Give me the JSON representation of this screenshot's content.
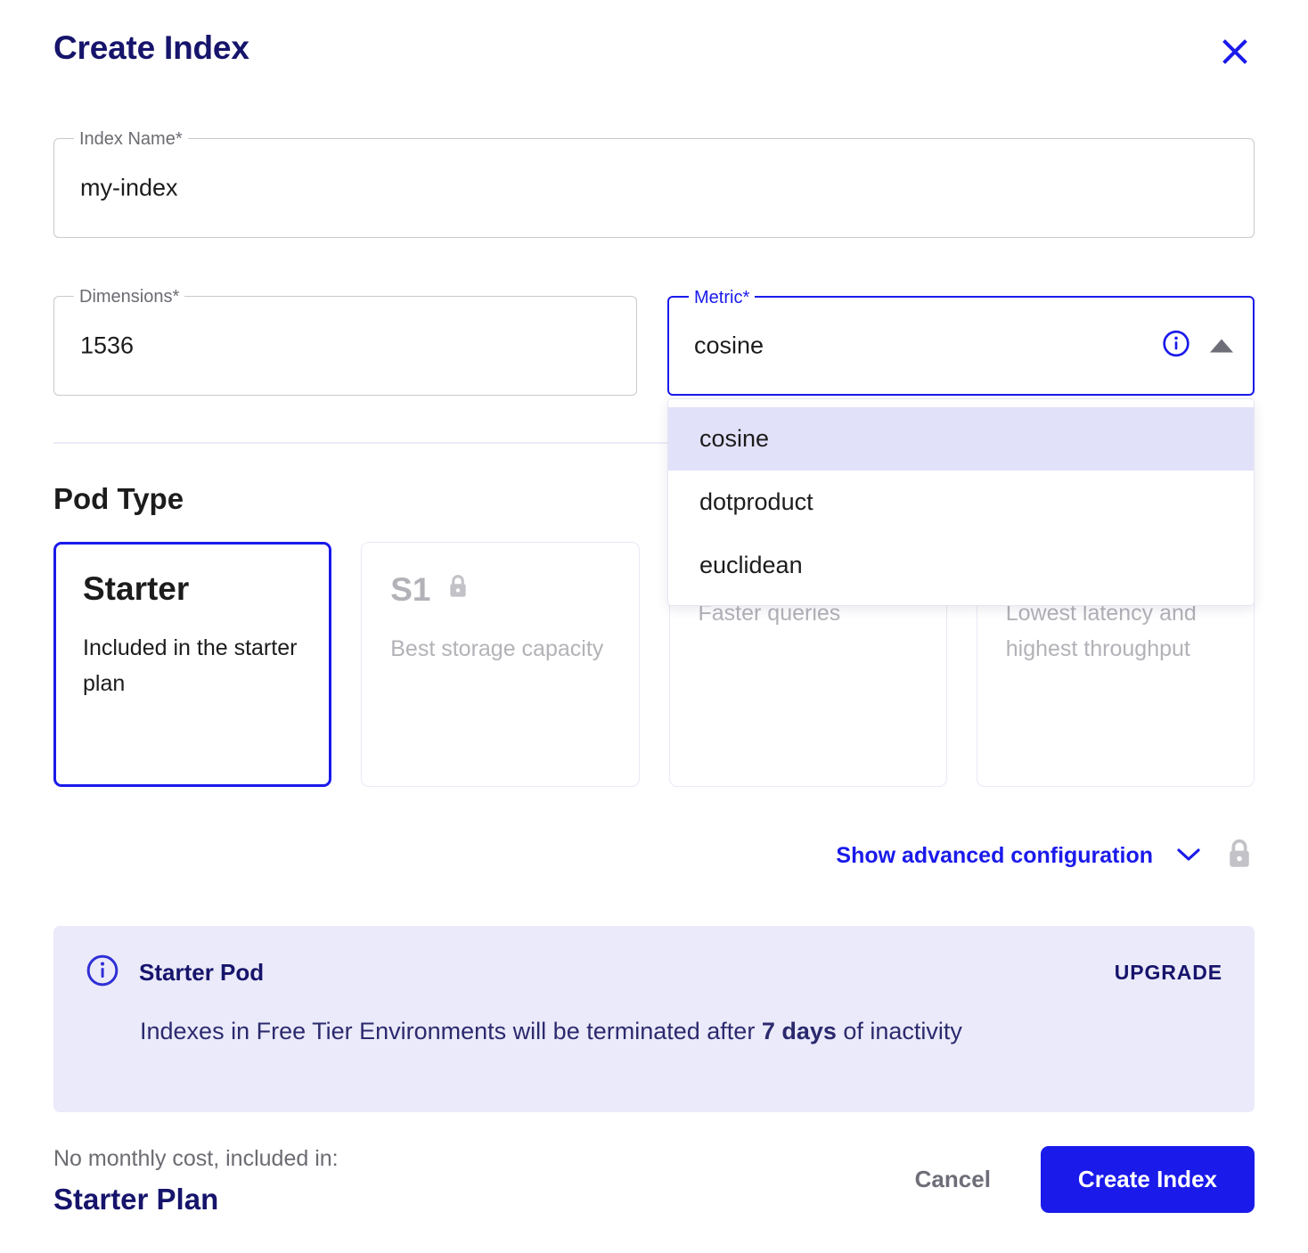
{
  "dialog": {
    "title": "Create Index",
    "close_icon": "close-icon"
  },
  "fields": {
    "index_name": {
      "label": "Index Name",
      "required_marker": "*",
      "value": "my-index",
      "placeholder": "Index Name"
    },
    "dimensions": {
      "label": "Dimensions",
      "required_marker": "*",
      "value": "1536",
      "placeholder": "Dimensions"
    },
    "metric": {
      "label": "Metric",
      "required_marker": "*",
      "value": "cosine",
      "info_icon": "info-circle-icon",
      "toggle_icon": "caret-up-icon",
      "options": [
        {
          "label": "cosine",
          "selected": true
        },
        {
          "label": "dotproduct",
          "selected": false
        },
        {
          "label": "euclidean",
          "selected": false
        }
      ]
    }
  },
  "pod_type": {
    "section_title": "Pod Type",
    "cards": [
      {
        "name": "Starter",
        "description": "Included in the starter plan",
        "selected": true,
        "locked": false,
        "lock_icon": ""
      },
      {
        "name": "S1",
        "description": "Best storage capacity",
        "selected": false,
        "locked": true,
        "lock_icon": "lock-icon"
      },
      {
        "name": "",
        "description": "Faster queries",
        "selected": false,
        "locked": true,
        "lock_icon": "lock-icon"
      },
      {
        "name": "",
        "description": "Lowest latency and highest throughput",
        "selected": false,
        "locked": true,
        "lock_icon": "lock-icon"
      }
    ]
  },
  "advanced": {
    "label": "Show advanced configuration",
    "chevron_icon": "chevron-down-icon",
    "lock_icon": "lock-icon"
  },
  "banner": {
    "info_icon": "info-circle-icon",
    "title": "Starter Pod",
    "upgrade_label": "UPGRADE",
    "text_before": "Indexes in Free Tier Environments will be terminated after ",
    "text_bold": "7 days",
    "text_after": " of inactivity"
  },
  "footer": {
    "plan_note": "No monthly cost, included in:",
    "plan_name": "Starter Plan",
    "cancel_label": "Cancel",
    "submit_label": "Create Index"
  },
  "colors": {
    "brand_blue": "#1a1aeb",
    "navy": "#16146b",
    "banner_bg": "#ebeafa",
    "highlight": "#e2e1fa",
    "muted": "#b2b2b8"
  }
}
